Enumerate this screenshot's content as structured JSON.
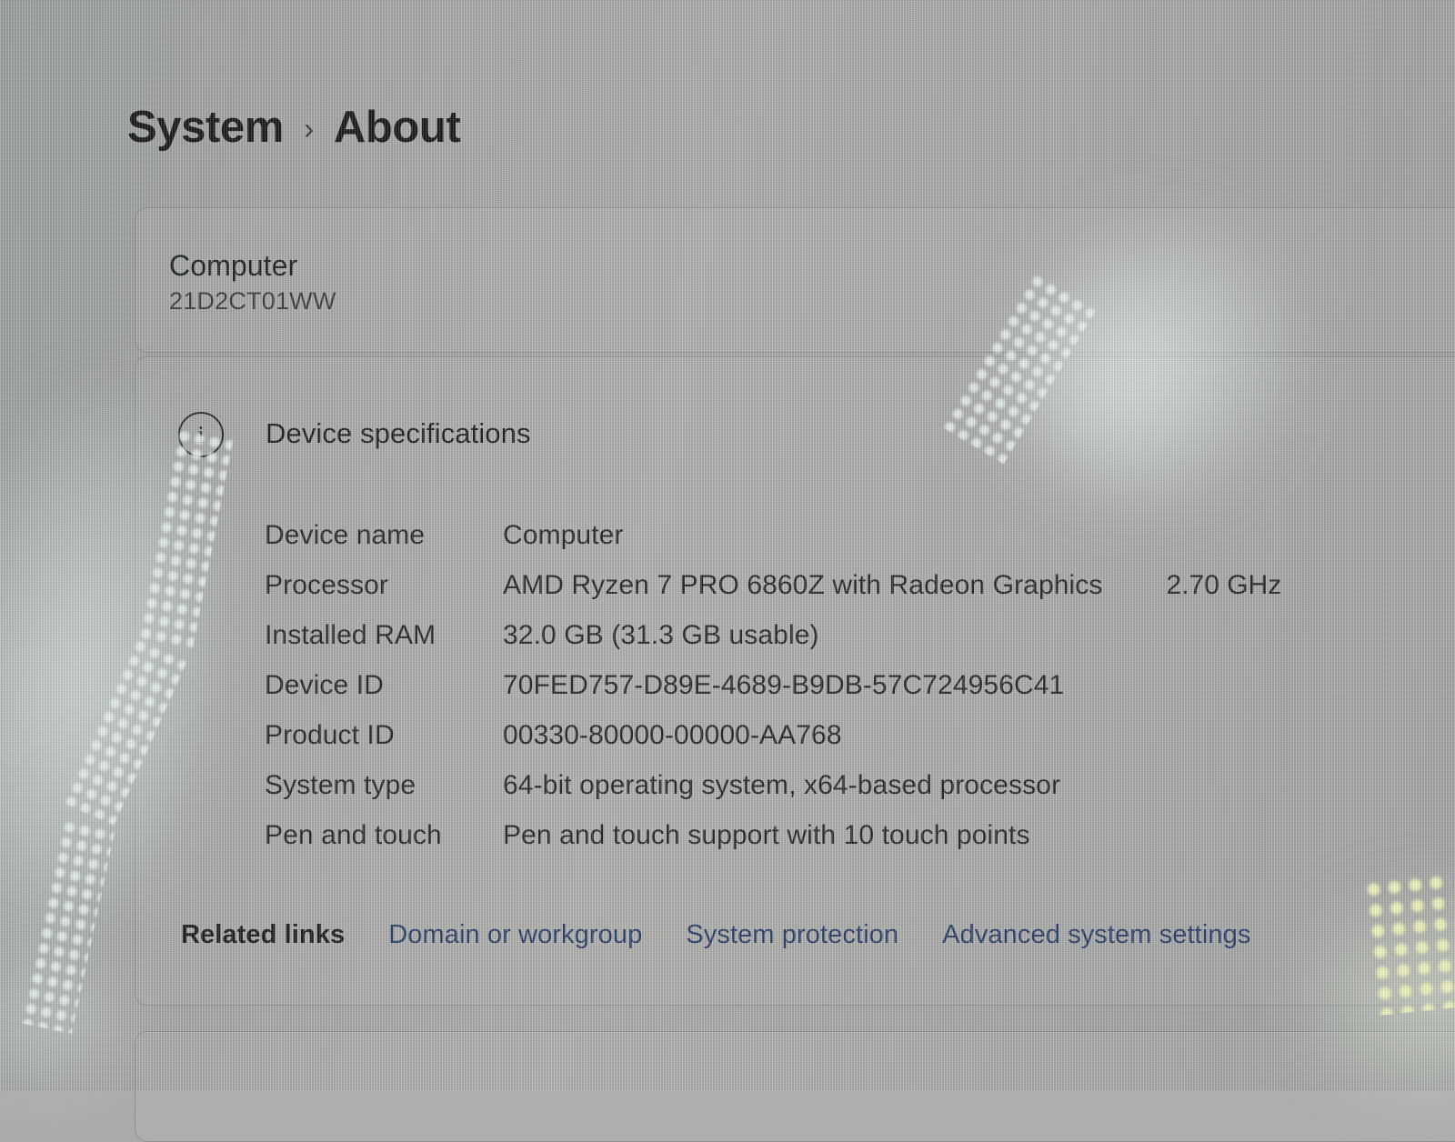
{
  "breadcrumb": {
    "root": "System",
    "separator": "›",
    "current": "About"
  },
  "computer_card": {
    "name": "Computer",
    "model": "21D2CT01WW"
  },
  "device_specifications": {
    "section_title": "Device specifications",
    "info_icon_glyph": "i",
    "rows": [
      {
        "label": "Device name",
        "value": "Computer",
        "extra": ""
      },
      {
        "label": "Processor",
        "value": "AMD Ryzen 7 PRO 6860Z with Radeon Graphics",
        "extra": "2.70 GHz"
      },
      {
        "label": "Installed RAM",
        "value": "32.0 GB (31.3 GB usable)",
        "extra": ""
      },
      {
        "label": "Device ID",
        "value": "70FED757-D89E-4689-B9DB-57C724956C41",
        "extra": ""
      },
      {
        "label": "Product ID",
        "value": "00330-80000-00000-AA768",
        "extra": ""
      },
      {
        "label": "System type",
        "value": "64-bit operating system, x64-based processor",
        "extra": ""
      },
      {
        "label": "Pen and touch",
        "value": "Pen and touch support with 10 touch points",
        "extra": ""
      }
    ]
  },
  "related_links": {
    "title": "Related links",
    "links": [
      "Domain or workgroup",
      "System protection",
      "Advanced system settings"
    ]
  },
  "colors": {
    "page_background": "#aaabaa",
    "text_primary": "#26292b",
    "heading": "#17191b",
    "link_accent": "#2a3f6b",
    "card_border": "rgba(70,76,80,0.30)"
  }
}
